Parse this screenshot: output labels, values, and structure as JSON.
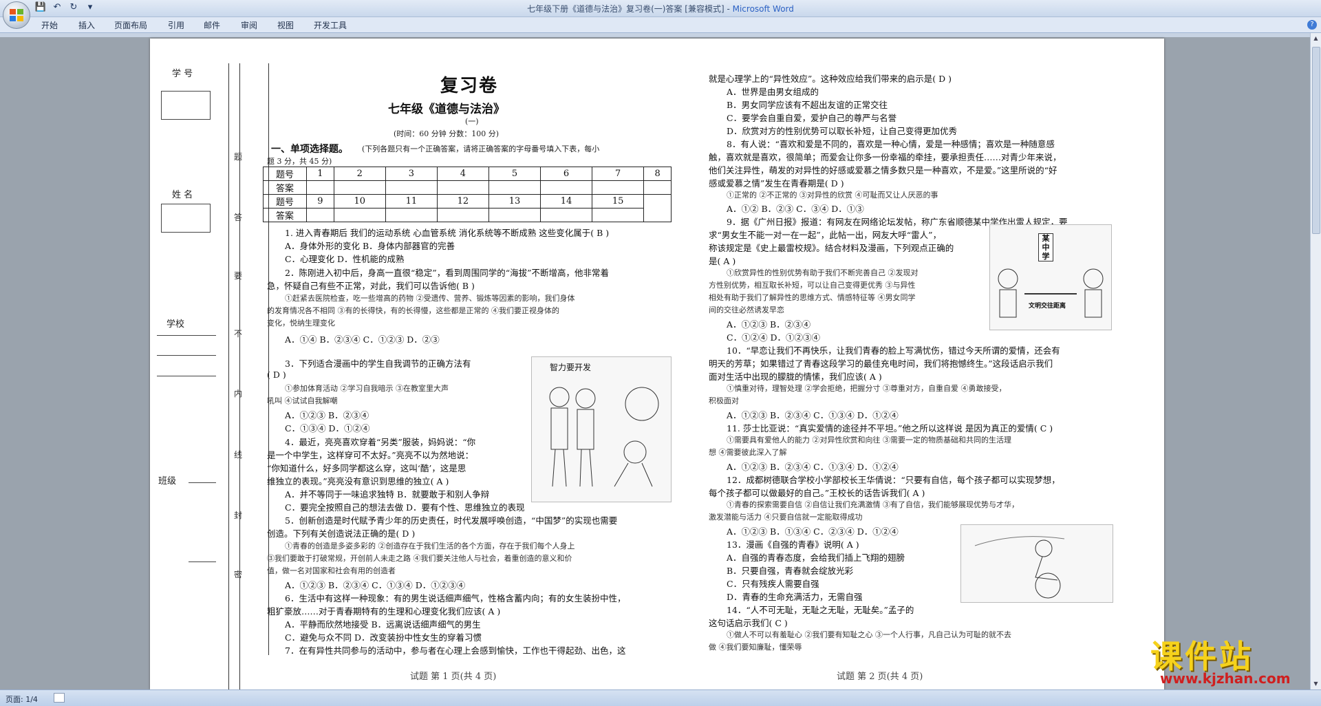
{
  "window": {
    "title": "七年级下册《道德与法治》复习卷(一)答案 [兼容模式] - ",
    "app": "Microsoft Word"
  },
  "ribbon": {
    "tabs": [
      "开始",
      "插入",
      "页面布局",
      "引用",
      "邮件",
      "审阅",
      "视图",
      "开发工具"
    ]
  },
  "qat": {
    "save_icon": "save-icon",
    "undo_icon": "undo-icon",
    "redo_icon": "redo-icon",
    "customize": "▾"
  },
  "help": "?",
  "statusbar": {
    "page": "页面: 1/4"
  },
  "sidebar": {
    "num_label": "学 号",
    "name_label": "姓 名",
    "school_label": "学校",
    "class_label": "班级",
    "seal_chars": [
      "题",
      "答",
      "要",
      "不",
      "内",
      "线",
      "封",
      "密"
    ]
  },
  "left": {
    "title": "复习卷",
    "subtitle": "七年级《道德与法治》",
    "part": "(一)",
    "timing": "(时间：60 分钟        分数：100 分)",
    "section1_head": "一、单项选择题。",
    "section1_note": "(下列各题只有一个正确答案，请将正确答案的字母番号填入下表，每小",
    "section1_note2": "题 3 分，共 45 分)",
    "table": {
      "row1_label": "题号",
      "row1": [
        "1",
        "2",
        "3",
        "4",
        "5",
        "6",
        "7",
        "8"
      ],
      "row2_label": "答案",
      "row3_label": "题号",
      "row3": [
        "9",
        "10",
        "11",
        "12",
        "13",
        "14",
        "15"
      ],
      "row4_label": "答案"
    },
    "q1": "1. 进入青春期后 我们的运动系统 心血管系统 消化系统等不断成熟 这些变化属于(   B   )",
    "q1a": "A．身体外形的变化                              B．身体内部器官的完善",
    "q1c": "C．心理变化   D．性机能的成熟",
    "q2": "2．陈刚进入初中后，身高一直很“稳定”，看到周围同学的“海拔”不断增高，他非常着",
    "q2b": "急，怀疑自己有些不正常，对此，我们可以告诉他(   B   )",
    "q2o1": "①赶紧去医院检查，吃一些增高的药物    ②受遗传、营养、锻炼等因素的影响，我们身体",
    "q2o2": "的发育情况各不相同    ③有的长得快，有的长得慢，这些都是正常的    ④我们要正视身体的",
    "q2o3": "变化，悦纳生理变化",
    "q2ans": "A．①④                       B．②③④                      C．①②③                      D．②③",
    "q3": "3．下列适合漫画中的学生自我调节的正确方法有",
    "q3b": "(   D   )",
    "q3o1": "①参加体育活动    ②学习自我暗示    ③在教室里大声",
    "q3o2": "吼叫    ④试试自我解嘲",
    "q3a1": "A．①②③    B．②③④",
    "q3a2": "C．①③④    D．①②④",
    "q4": "4．最近，亮亮喜欢穿着“另类”服装，妈妈说：“你",
    "q4b": "是一个中学生，这样穿可不太好。”亮亮不以为然地说：",
    "q4c": "“你知道什么，好多同学都这么穿，这叫‘酷’，这是思",
    "q4d": "维独立的表现。”亮亮没有意识到思维的独立(   A   )",
    "q4a1": "A．并不等同于一味追求独特    B．就要敢于和别人争辩",
    "q4a2": "C．要完全按照自己的想法去做    D．要有个性、思维独立的表现",
    "q5": "5．创新创造是时代赋予青少年的历史责任，时代发展呼唤创造，“中国梦”的实现也需要",
    "q5b": "创造。下列有关创造说法正确的是(   D   )",
    "q5o1": "①青春的创造是多姿多彩的    ②创造存在于我们生活的各个方面，存在于我们每个人身上",
    "q5o2": "③我们要敢于打破常规，开创前人未走之路    ④我们要关注他人与社会，着重创造的意义和价",
    "q5o3": "值，做一名对国家和社会有用的创造者",
    "q5ans": "A．①②③    B．②③④    C．①③④    D．①②③④",
    "q6": "6．生活中有这样一种现象：有的男生说话细声细气，性格含蓄内向；有的女生装扮中性，",
    "q6b": "粗犷豪放……对于青春期特有的生理和心理变化我们应该(   A   )",
    "q6a1": "A．平静而欣然地接受    B．远离说话细声细气的男生",
    "q6a2": "C．避免与众不同    D．改变装扮中性女生的穿着习惯",
    "q7": "7．在有异性共同参与的活动中，参与者在心理上会感到愉快，工作也干得起劲、出色，这",
    "cartoon1_title": "智力要开发",
    "footer": "试题    第 1 页(共 4 页)"
  },
  "right": {
    "q7b": "就是心理学上的“异性效应”。这种效应给我们带来的启示是(   D   )",
    "q7a": "A．世界是由男女组成的",
    "q7bb": "B．男女同学应该有不超出友谊的正常交往",
    "q7c": "C．要学会自重自爱，爱护自己的尊严与名誉",
    "q7d": "D．欣赏对方的性别优势可以取长补短，让自己变得更加优秀",
    "q8": "8．有人说：“喜欢和爱是不同的，喜欢是一种心情，爱是一种感情；喜欢是一种随意感",
    "q8b": "触，喜欢就是喜欢，很简单；而爱会让你多一份幸福的牵挂，要承担责任……对青少年来说，",
    "q8c": "他们关注异性，萌发的对异性的好感或爱慕之情多数只是一种喜欢，不是爱。”这里所说的“好",
    "q8d": "感或爱慕之情”发生在青春期是(   D   )",
    "q8o": "①正常的    ②不正常的    ③对异性的欣赏    ④可耻而又让人厌恶的事",
    "q8ans": "A．①②   B．②③   C．③④   D．①③",
    "q9": "9．据《广州日报》报道：有网友在网络论坛发帖，称广东省顺德某中学作出雷人规定，要",
    "q9b": "求“男女生不能一对一在一起”，此帖一出，网友大呼“雷人”，",
    "q9c": "称该规定是《史上最雷校规》。结合材料及漫画，下列观点正确的",
    "q9d": "是(   A   )",
    "q9o1": "①欣赏异性的性别优势有助于我们不断完善自己    ②发现对",
    "q9o2": "方性别优势，相互取长补短，可以让自己变得更优秀    ③与异性",
    "q9o3": "相处有助于我们了解异性的思维方式、情感特征等    ④男女同学",
    "q9o4": "间的交往必然诱发早恋",
    "q9a1": "A．①②③    B．②③④",
    "q9a2": "C．①②④    D．①②③④",
    "q10": "10．“早恋让我们不再快乐，让我们青春的脸上写满忧伤，错过今天所谓的爱情，还会有",
    "q10b": "明天的芳草；如果错过了青春这段学习的最佳充电时间，我们将抱憾终生。”这段话启示我们",
    "q10c": "面对生活中出现的朦胧的情愫，我们应该(   A   )",
    "q10o1": "①慎重对待，理智处理    ②学会拒绝，把握分寸    ③尊重对方，自重自爱    ④勇敢接受，",
    "q10o2": "积极面对",
    "q10ans": "A．①②③   B．②③④   C．①③④   D．①②④",
    "q11": "11. 莎士比亚说：“真实爱情的途径并不平坦。”他之所以这样说 是因为真正的爱情(   C   )",
    "q11o1": "①需要具有爱他人的能力    ②对异性欣赏和向往    ③需要一定的物质基础和共同的生活理",
    "q11o2": "想    ④需要彼此深入了解",
    "q11ans": "A．①②③   B．②③④   C．①③④   D．①②④",
    "q12": "12．成都树德联合学校小学部校长王华倩说：“只要有自信，每个孩子都可以实现梦想，",
    "q12b": "每个孩子都可以做最好的自己。”王校长的话告诉我们(   A   )",
    "q12o1": "①青春的探索需要自信    ②自信让我们充满激情    ③有了自信，我们能够展现优势与才华，",
    "q12o2": "激发潜能与活力    ④只要自信就一定能取得成功",
    "q12ans": "A．①②③   B．①③④   C．②③④   D．①②④",
    "q13": "13．漫画《自强的青春》说明(   A   )",
    "q13a": "A．自强的青春态度，会给我们插上飞翔的翅膀",
    "q13b": "B．只要自强，青春就会绽放光彩",
    "q13c": "C．只有残疾人需要自强",
    "q13d": "D．青春的生命充满活力，无需自强",
    "q14": "14．“人不可无耻，无耻之无耻，无耻矣。”孟子的",
    "q14b": "这句话启示我们(   C   )",
    "q14o1": "①做人不可以有羞耻心    ②我们要有知耻之心    ③一个人行事，凡自己认为可耻的就不去",
    "q14o2": "做    ④我们要知廉耻，懂荣辱",
    "cartoon2_label": "某中学",
    "cartoon2_caption": "文明交往距离",
    "footer": "试题    第 2 页(共 4 页)"
  },
  "watermark": {
    "cn": "课件站",
    "url": "www.kjzhan.com"
  }
}
